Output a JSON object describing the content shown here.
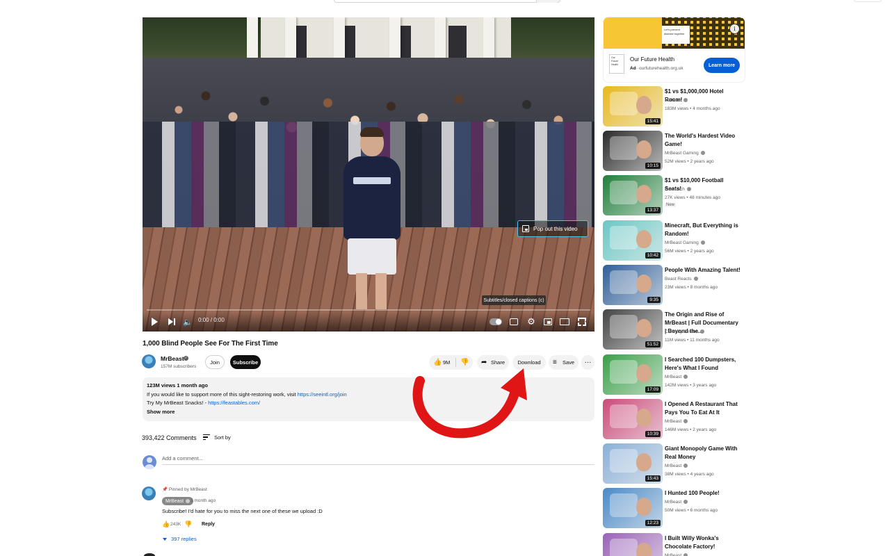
{
  "player": {
    "popout_label": "Pop out this video",
    "tooltip": "Subtitles/closed captions (c)",
    "time": "0:00 / 0:00"
  },
  "video": {
    "title": "1,000 Blind People See For The First Time",
    "channel": "MrBeast",
    "subscribers": "157M subscribers",
    "join_label": "Join",
    "subscribe_label": "Subscribe",
    "likes": "9M",
    "share_label": "Share",
    "download_label": "Download",
    "save_label": "Save",
    "more_label": "···"
  },
  "description": {
    "meta": "123M views  1 month ago",
    "line1_text": "If you would like to support more of this sight-restoring work, visit ",
    "line1_link": "https://seeintl.org/join",
    "line2_text": "Try My MrBeast Snacks! - ",
    "line2_link": "https://feastables.com/",
    "show_more": "Show more"
  },
  "comments": {
    "count": "393,422 Comments",
    "sort_label": "Sort by",
    "add_placeholder": "Add a comment...",
    "pinned_label": "Pinned by MrBeast",
    "author": "MrBeast",
    "time": "1 month ago",
    "text": "Subscribe! I'd hate for you to miss the next one of these we upload :D",
    "likes": "243K",
    "reply_label": "Reply",
    "replies": "397 replies"
  },
  "ad": {
    "banner_text": "Let's prevent disease together",
    "logo_text": "Our Future Health",
    "title": "Our Future Health",
    "ad_label": "Ad",
    "url": "· ourfuturehealth.org.uk",
    "cta": "Learn more",
    "info_label": "i"
  },
  "recommendations": [
    {
      "title": "$1 vs $1,000,000 Hotel Room!",
      "channel": "MrBeast",
      "views": "183M views • 4 months ago",
      "duration": "15:41"
    },
    {
      "title": "The World's Hardest Video Game!",
      "channel": "MrBeast Gaming",
      "views": "52M views • 2 years ago",
      "duration": "10:15"
    },
    {
      "title": "$1 vs $10,000 Football Seats!",
      "channel": "Futcrunch",
      "views": "27K views • 48 minutes ago",
      "duration": "13:37",
      "badge": "New"
    },
    {
      "title": "Minecraft, But Everything is Random!",
      "channel": "MrBeast Gaming",
      "views": "56M views • 2 years ago",
      "duration": "10:42"
    },
    {
      "title": "People With Amazing Talent!",
      "channel": "Beast Reacts",
      "views": "23M views • 8 months ago",
      "duration": "9:35"
    },
    {
      "title": "The Origin and Rise of MrBeast | Full Documentary | Beyond the...",
      "channel": "Curiosity Stream",
      "views": "11M views • 11 months ago",
      "duration": "51:52"
    },
    {
      "title": "I Searched 100 Dumpsters, Here's What I Found",
      "channel": "MrBeast",
      "views": "142M views • 3 years ago",
      "duration": "17:09"
    },
    {
      "title": "I Opened A Restaurant That Pays You To Eat At It",
      "channel": "MrBeast",
      "views": "146M views • 2 years ago",
      "duration": "10:39"
    },
    {
      "title": "Giant Monopoly Game With Real Money",
      "channel": "MrBeast",
      "views": "38M views • 4 years ago",
      "duration": "15:43"
    },
    {
      "title": "I Hunted 100 People!",
      "channel": "MrBeast",
      "views": "50M views • 6 months ago",
      "duration": "12:23"
    },
    {
      "title": "I Built Willy Wonka's Chocolate Factory!",
      "channel": "MrBeast",
      "views": "",
      "duration": ""
    }
  ],
  "thumb_colors": [
    "#e8b81c",
    "#2a2a2a",
    "#1f7f3a",
    "#6ac7c4",
    "#2f5f9a",
    "#444444",
    "#3aa047",
    "#cc4a7a",
    "#8ab0d8",
    "#4a8ac8",
    "#9a62b8"
  ]
}
